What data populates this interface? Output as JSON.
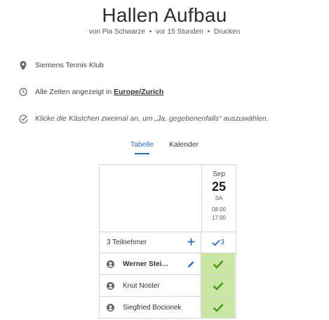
{
  "poll": {
    "title": "Hallen Aufbau",
    "author_text": "von Pia Schwarze",
    "time_ago": "vor 15 Stunden",
    "print_label": "Drucken",
    "separator": "•"
  },
  "info": {
    "location": "Siemens Tennis Klub",
    "timezone_prefix": "Alle Zeiten angezeigt in",
    "timezone": "Europe/Zurich",
    "hint": "Klicke die Kästchen zweimal an, um „Ja, gegebenenfalls“ auszuwählen."
  },
  "tabs": [
    {
      "label": "Tabelle",
      "active": true
    },
    {
      "label": "Kalender",
      "active": false
    }
  ],
  "option": {
    "month": "Sep",
    "day": "25",
    "weekday": "SA",
    "start": "08:00",
    "end": "17:00"
  },
  "summary": {
    "participants_label": "3 Teilnehmer",
    "yes_count": "3"
  },
  "participants": [
    {
      "name": "Werner Stei…",
      "answer": "yes",
      "editable": true
    },
    {
      "name": "Knut Noster",
      "answer": "yes",
      "editable": false
    },
    {
      "name": "Siegfried Bocionek",
      "answer": "yes",
      "editable": false
    }
  ],
  "colors": {
    "accent": "#2a6ab3",
    "yes_bg": "#c9e6a5",
    "check": "#4e9a1c"
  }
}
